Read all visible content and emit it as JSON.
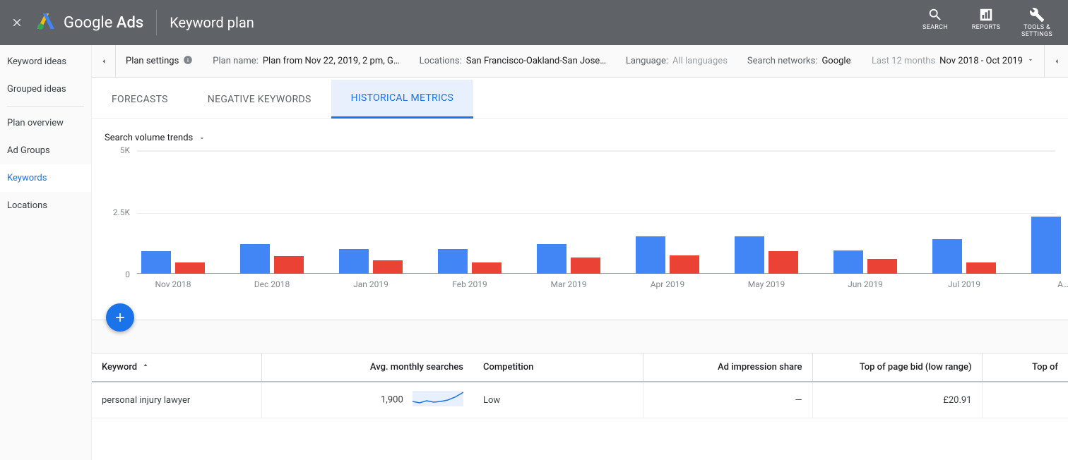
{
  "header": {
    "product_prefix": "Google",
    "product_suffix": "Ads",
    "page_title": "Keyword plan",
    "actions": {
      "search": "SEARCH",
      "reports": "REPORTS",
      "tools": "TOOLS & SETTINGS"
    }
  },
  "settings_bar": {
    "plan_settings_label": "Plan settings",
    "plan_name_label": "Plan name:",
    "plan_name_value": "Plan from Nov 22, 2019, 2 pm, G…",
    "locations_label": "Locations:",
    "locations_value": "San Francisco-Oakland-San Jose…",
    "language_label": "Language:",
    "language_value": "All languages",
    "networks_label": "Search networks:",
    "networks_value": "Google",
    "daterange_prefix": "Last 12 months",
    "daterange_value": "Nov 2018 - Oct 2019"
  },
  "left_nav": {
    "items": [
      {
        "label": "Keyword ideas"
      },
      {
        "label": "Grouped ideas"
      },
      {
        "label": "Plan overview"
      },
      {
        "label": "Ad Groups"
      },
      {
        "label": "Keywords"
      },
      {
        "label": "Locations"
      }
    ],
    "active_index": 4
  },
  "tabs": {
    "items": [
      "FORECASTS",
      "NEGATIVE KEYWORDS",
      "HISTORICAL METRICS"
    ],
    "active_index": 2
  },
  "chart": {
    "dropdown_label": "Search volume trends",
    "y_max": 5000,
    "y_ticks": [
      {
        "label": "5K",
        "value": 5000
      },
      {
        "label": "2.5K",
        "value": 2500
      },
      {
        "label": "0",
        "value": 0
      }
    ]
  },
  "chart_data": {
    "type": "bar",
    "ylim": [
      0,
      5000
    ],
    "ylabel": "",
    "xlabel": "",
    "title": "Search volume trends",
    "categories": [
      "Nov 2018",
      "Dec 2018",
      "Jan 2019",
      "Feb 2019",
      "Mar 2019",
      "Apr 2019",
      "May 2019",
      "Jun 2019",
      "Jul 2019",
      "A…"
    ],
    "series": [
      {
        "name": "series_a",
        "color": "#4285f4",
        "values": [
          900,
          1200,
          1000,
          1000,
          1200,
          1500,
          1500,
          950,
          1400,
          2300
        ]
      },
      {
        "name": "series_b",
        "color": "#ea4335",
        "values": [
          450,
          700,
          550,
          450,
          650,
          750,
          900,
          600,
          450,
          0
        ]
      }
    ]
  },
  "table": {
    "columns": [
      "Keyword",
      "Avg. monthly searches",
      "Competition",
      "Ad impression share",
      "Top of page bid (low range)",
      "Top of"
    ],
    "rows": [
      {
        "keyword": "personal injury lawyer",
        "avg_monthly_searches": "1,900",
        "competition": "Low",
        "ad_impression_share": "—",
        "top_bid_low": "£20.91"
      }
    ]
  }
}
